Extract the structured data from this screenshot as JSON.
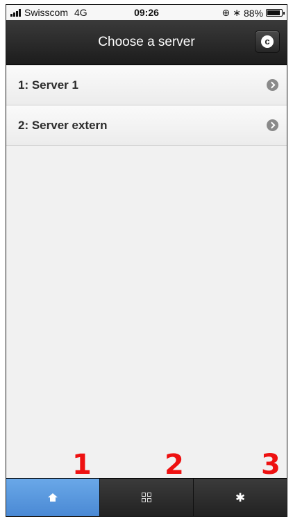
{
  "status_bar": {
    "carrier": "Swisscom",
    "network": "4G",
    "time": "09:26",
    "battery": "88%",
    "battery_level": 0.88
  },
  "header": {
    "title": "Choose a server",
    "refresh_icon": "c"
  },
  "servers": [
    {
      "label": "1: Server 1"
    },
    {
      "label": "2: Server extern"
    }
  ],
  "annotations": [
    "1",
    "2",
    "3"
  ],
  "tabs": [
    {
      "icon": "home-icon",
      "active": true
    },
    {
      "icon": "qr-code-icon",
      "active": false
    },
    {
      "icon": "gear-icon",
      "active": false
    }
  ],
  "colors": {
    "active_tab": "#5b9be0",
    "annotation": "#ee1111",
    "header": "#262626"
  }
}
